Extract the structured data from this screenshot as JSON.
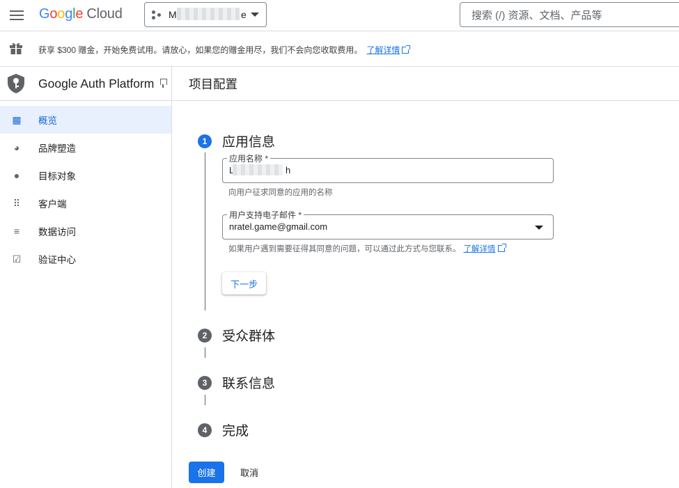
{
  "topbar": {
    "logo_letters": [
      "G",
      "o",
      "o",
      "g",
      "l",
      "e"
    ],
    "logo_suffix": "Cloud",
    "project_name": "M",
    "project_name_tail": "e",
    "search_placeholder": "搜索 (/) 资源、文档、产品等"
  },
  "banner": {
    "text": "获享 $300 赠金，开始免费试用。请放心，如果您的赠金用尽，我们不会向您收取费用。",
    "link": "了解详情"
  },
  "sidebar": {
    "title": "Google Auth Platform",
    "items": [
      {
        "label": "概览",
        "icon": "dashboard-icon",
        "glyph": "▦",
        "active": true
      },
      {
        "label": "品牌塑造",
        "icon": "palette-icon",
        "glyph": "◕",
        "active": false
      },
      {
        "label": "目标对象",
        "icon": "person-icon",
        "glyph": "●",
        "active": false
      },
      {
        "label": "客户端",
        "icon": "apps-grid-icon",
        "glyph": "⠿",
        "active": false
      },
      {
        "label": "数据访问",
        "icon": "data-settings-icon",
        "glyph": "≡",
        "active": false
      },
      {
        "label": "验证中心",
        "icon": "verified-check-icon",
        "glyph": "☑",
        "active": false
      }
    ]
  },
  "main": {
    "title": "项目配置",
    "steps": [
      {
        "number": "1",
        "title": "应用信息",
        "state": "active"
      },
      {
        "number": "2",
        "title": "受众群体",
        "state": "pending"
      },
      {
        "number": "3",
        "title": "联系信息",
        "state": "pending"
      },
      {
        "number": "4",
        "title": "完成",
        "state": "pending"
      }
    ],
    "app_name": {
      "label": "应用名称 *",
      "value_start": "L",
      "value_end": "h",
      "hint": "向用户征求同意的应用的名称"
    },
    "support_email": {
      "label": "用户支持电子邮件 *",
      "value": "nratel.game@gmail.com",
      "hint": "如果用户遇到需要征得其同意的问题，可以通过此方式与您联系。",
      "hint_link": "了解详情"
    },
    "next_button": "下一步",
    "create_button": "创建",
    "cancel_button": "取消"
  },
  "colors": {
    "accent": "#1a73e8",
    "active_nav_bg": "#e8f0fe",
    "step_pending": "#5f6368"
  }
}
